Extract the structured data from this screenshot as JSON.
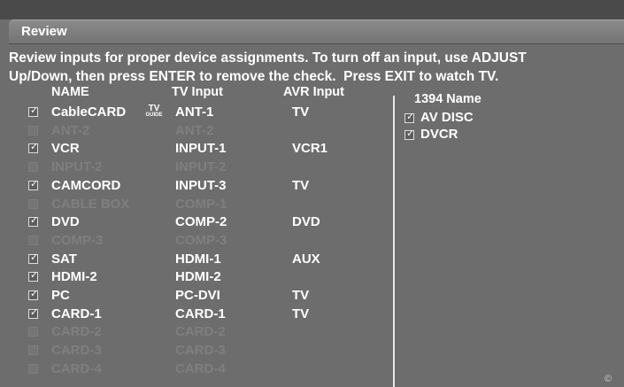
{
  "panel": {
    "title": "Review",
    "instructions_line1": "Review inputs for proper device assignments. To turn off an input, use ADJUST",
    "instructions_line2": "Up/Down, then press ENTER to remove the check.  Press EXIT to watch TV."
  },
  "inputs_table": {
    "headers": {
      "name": "NAME",
      "tv_input": "TV  Input",
      "avr_input": "AVR Input"
    },
    "rows": [
      {
        "name": "CableCARD",
        "tv_input": "ANT-1",
        "avr_input": "TV",
        "checked": true,
        "enabled": true,
        "badge": "TV GUIDE"
      },
      {
        "name": "ANT-2",
        "tv_input": "ANT-2",
        "avr_input": "",
        "checked": false,
        "enabled": false
      },
      {
        "name": "VCR",
        "tv_input": "INPUT-1",
        "avr_input": "VCR1",
        "checked": true,
        "enabled": true
      },
      {
        "name": "INPUT-2",
        "tv_input": "INPUT-2",
        "avr_input": "",
        "checked": false,
        "enabled": false
      },
      {
        "name": "CAMCORD",
        "tv_input": "INPUT-3",
        "avr_input": "TV",
        "checked": true,
        "enabled": true
      },
      {
        "name": "CABLE BOX",
        "tv_input": "COMP-1",
        "avr_input": "",
        "checked": false,
        "enabled": false
      },
      {
        "name": "DVD",
        "tv_input": "COMP-2",
        "avr_input": "DVD",
        "checked": true,
        "enabled": true
      },
      {
        "name": "COMP-3",
        "tv_input": "COMP-3",
        "avr_input": "",
        "checked": false,
        "enabled": false
      },
      {
        "name": "SAT",
        "tv_input": "HDMI-1",
        "avr_input": "AUX",
        "checked": true,
        "enabled": true
      },
      {
        "name": "HDMI-2",
        "tv_input": "HDMI-2",
        "avr_input": "",
        "checked": true,
        "enabled": true
      },
      {
        "name": "PC",
        "tv_input": "PC-DVI",
        "avr_input": "TV",
        "checked": true,
        "enabled": true
      },
      {
        "name": "CARD-1",
        "tv_input": "CARD-1",
        "avr_input": "TV",
        "checked": true,
        "enabled": true
      },
      {
        "name": "CARD-2",
        "tv_input": "CARD-2",
        "avr_input": "",
        "checked": false,
        "enabled": false
      },
      {
        "name": "CARD-3",
        "tv_input": "CARD-3",
        "avr_input": "",
        "checked": false,
        "enabled": false
      },
      {
        "name": "CARD-4",
        "tv_input": "CARD-4",
        "avr_input": "",
        "checked": false,
        "enabled": false
      }
    ]
  },
  "firewire_list": {
    "header": "1394 Name",
    "rows": [
      {
        "name": "AV DISC",
        "checked": true
      },
      {
        "name": "DVCR",
        "checked": true
      }
    ]
  },
  "footer": {
    "copyright": "©"
  },
  "icons": {
    "checkbox_check": "checkmark-icon",
    "tv_guide": "tv-guide-logo"
  }
}
